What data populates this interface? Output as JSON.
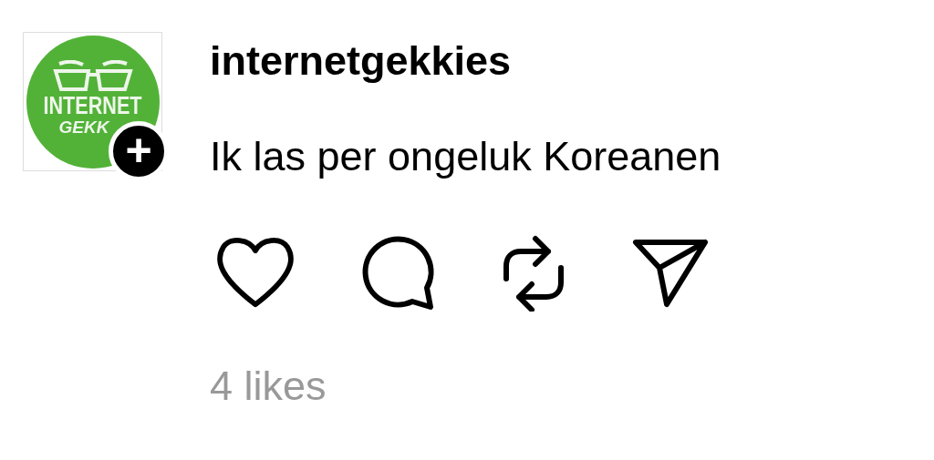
{
  "post": {
    "avatar": {
      "logo_lines": [
        "INTERNET",
        "GEKK"
      ]
    },
    "follow_badge": "+",
    "username": "internetgekkies",
    "text": "Ik las per ongeluk Koreanen",
    "actions": [
      {
        "kind": "like"
      },
      {
        "kind": "comment"
      },
      {
        "kind": "repost"
      },
      {
        "kind": "share"
      }
    ],
    "likes": "4 likes"
  }
}
